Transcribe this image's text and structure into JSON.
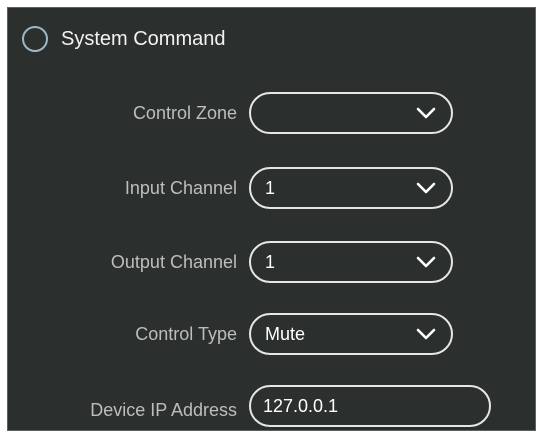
{
  "header": {
    "title": "System Command",
    "radio_icon": "radio-circle-icon"
  },
  "fields": {
    "control_zone": {
      "label": "Control Zone",
      "value": ""
    },
    "input_channel": {
      "label": "Input Channel",
      "value": "1"
    },
    "output_channel": {
      "label": "Output Channel",
      "value": "1"
    },
    "control_type": {
      "label": "Control Type",
      "value": "Mute"
    },
    "device_ip": {
      "label": "Device IP Address",
      "value": "127.0.0.1"
    }
  },
  "icons": {
    "dropdown": "chevron-down-icon"
  },
  "colors": {
    "panel_background": "#2b302f",
    "label_text": "#bdbdbd",
    "value_text": "#ffffff",
    "control_border": "#e6e6e6",
    "radio_border": "#9fb6c4"
  }
}
